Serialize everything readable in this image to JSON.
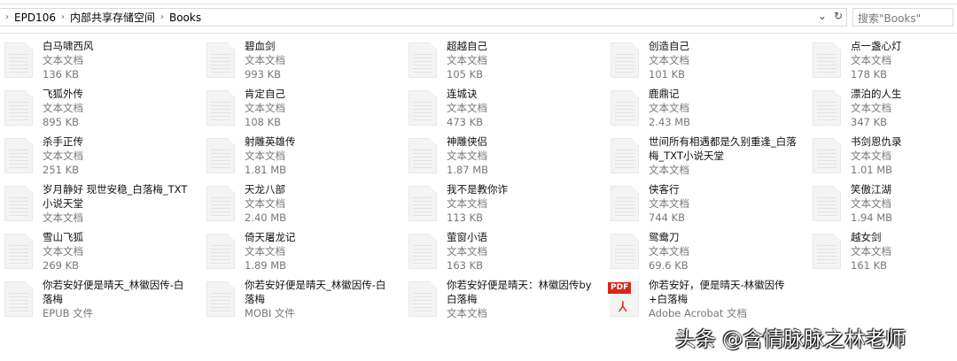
{
  "breadcrumb": [
    "EPD106",
    "内部共享存储空间",
    "Books"
  ],
  "search": {
    "placeholder": "搜索\"Books\""
  },
  "icons": {
    "dropdown": "chevron-down-icon",
    "refresh": "refresh-icon"
  },
  "files": [
    {
      "name": "白马啸西风",
      "type": "文本文档",
      "size": "136 KB"
    },
    {
      "name": "碧血剑",
      "type": "文本文档",
      "size": "993 KB"
    },
    {
      "name": "超越自己",
      "type": "文本文档",
      "size": "105 KB"
    },
    {
      "name": "创造自己",
      "type": "文本文档",
      "size": "101 KB"
    },
    {
      "name": "点一盏心灯",
      "type": "文本文档",
      "size": "178 KB"
    },
    {
      "name": "飞狐外传",
      "type": "文本文档",
      "size": "895 KB"
    },
    {
      "name": "肯定自己",
      "type": "文本文档",
      "size": "108 KB"
    },
    {
      "name": "连城诀",
      "type": "文本文档",
      "size": "473 KB"
    },
    {
      "name": "鹿鼎记",
      "type": "文本文档",
      "size": "2.43 MB"
    },
    {
      "name": "漂泊的人生",
      "type": "文本文档",
      "size": "347 KB"
    },
    {
      "name": "杀手正传",
      "type": "文本文档",
      "size": "251 KB"
    },
    {
      "name": "射雕英雄传",
      "type": "文本文档",
      "size": "1.81 MB"
    },
    {
      "name": "神雕侠侣",
      "type": "文本文档",
      "size": "1.87 MB"
    },
    {
      "name": "世间所有相遇都是久别重逢_白落梅_TXT小说天堂",
      "type": "文本文档",
      "size": ""
    },
    {
      "name": "书剑恩仇录",
      "type": "文本文档",
      "size": "1.01 MB"
    },
    {
      "name": "岁月静好 现世安稳_白落梅_TXT小说天堂",
      "type": "文本文档",
      "size": ""
    },
    {
      "name": "天龙八部",
      "type": "文本文档",
      "size": "2.40 MB"
    },
    {
      "name": "我不是教你诈",
      "type": "文本文档",
      "size": "113 KB"
    },
    {
      "name": "侠客行",
      "type": "文本文档",
      "size": "744 KB"
    },
    {
      "name": "笑傲江湖",
      "type": "文本文档",
      "size": "1.94 MB"
    },
    {
      "name": "雪山飞狐",
      "type": "文本文档",
      "size": "269 KB"
    },
    {
      "name": "倚天屠龙记",
      "type": "文本文档",
      "size": "1.89 MB"
    },
    {
      "name": "萤窗小语",
      "type": "文本文档",
      "size": "163 KB"
    },
    {
      "name": "鸳鸯刀",
      "type": "文本文档",
      "size": "69.6 KB"
    },
    {
      "name": "越女剑",
      "type": "文本文档",
      "size": "161 KB"
    },
    {
      "name": "你若安好便是晴天_林徽因传-白落梅",
      "type": "EPUB 文件",
      "size": ""
    },
    {
      "name": "你若安好便是晴天_林徽因传-白落梅",
      "type": "MOBI 文件",
      "size": ""
    },
    {
      "name": "你若安好便是晴天：林徽因传by白落梅",
      "type": "文本文档",
      "size": ""
    },
    {
      "name": "你若安好，便是晴天-林徽因传+白落梅",
      "type": "Adobe Acrobat 文档",
      "size": "",
      "pdf": true
    }
  ],
  "pdf_badge": "PDF",
  "watermark": "头条 @含情脉脉之林老师"
}
